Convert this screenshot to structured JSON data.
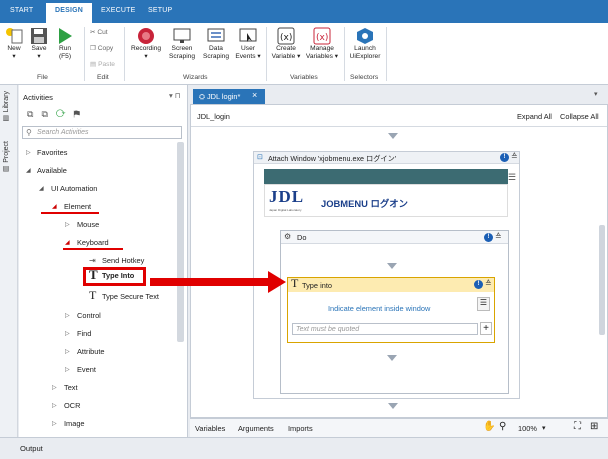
{
  "menu_tabs": [
    "START",
    "DESIGN",
    "EXECUTE",
    "SETUP"
  ],
  "ribbon": {
    "new": "New",
    "save": "Save",
    "run": "Run",
    "run_key": "(F5)",
    "cut": "Cut",
    "copy": "Copy",
    "paste": "Paste",
    "recording": "Recording",
    "screen": "Screen",
    "scraping": "Scraping",
    "data": "Data",
    "data_scraping": "Scraping",
    "user": "User",
    "events": "Events",
    "create": "Create",
    "variable": "Variable",
    "manage": "Manage",
    "variables": "Variables",
    "launch": "Launch",
    "uiexplorer": "UiExplorer",
    "groups": {
      "file": "File",
      "edit": "Edit",
      "wizards": "Wizards",
      "variables": "Variables",
      "selectors": "Selectors"
    }
  },
  "side_tabs": {
    "library": "Library",
    "project": "Project"
  },
  "activities": {
    "title": "Activities",
    "search_placeholder": "Search Activities",
    "tree": {
      "favorites": "Favorites",
      "available": "Available",
      "ui_automation": "UI Automation",
      "element": "Element",
      "mouse": "Mouse",
      "keyboard": "Keyboard",
      "send_hotkey": "Send Hotkey",
      "type_into": "Type Into",
      "type_secure": "Type Secure Text",
      "control": "Control",
      "find": "Find",
      "attribute": "Attribute",
      "event": "Event",
      "text": "Text",
      "ocr": "OCR",
      "image": "Image"
    }
  },
  "doc_tab": {
    "label": "JDL login*",
    "close": "×"
  },
  "breadcrumb": {
    "name": "JDL_login",
    "expand": "Expand All",
    "collapse": "Collapse All"
  },
  "attach": {
    "title": "Attach Window 'xjobmenu.exe  ログイン'",
    "logo_text": "JDL",
    "logo_sub": "Japan Digital Laboratory",
    "app_title": "JOBMENU ログオン"
  },
  "do_block": {
    "title": "Do"
  },
  "type_into": {
    "title": "Type into",
    "indicate": "Indicate element inside window",
    "input_placeholder": "Text must be quoted",
    "add": "+"
  },
  "bottom": {
    "variables": "Variables",
    "arguments": "Arguments",
    "imports": "Imports",
    "zoom": "100%"
  },
  "output": "Output",
  "colors": {
    "accent": "#2a74b8",
    "highlight_red": "#e00000",
    "type_into_header": "#fdebb1"
  }
}
